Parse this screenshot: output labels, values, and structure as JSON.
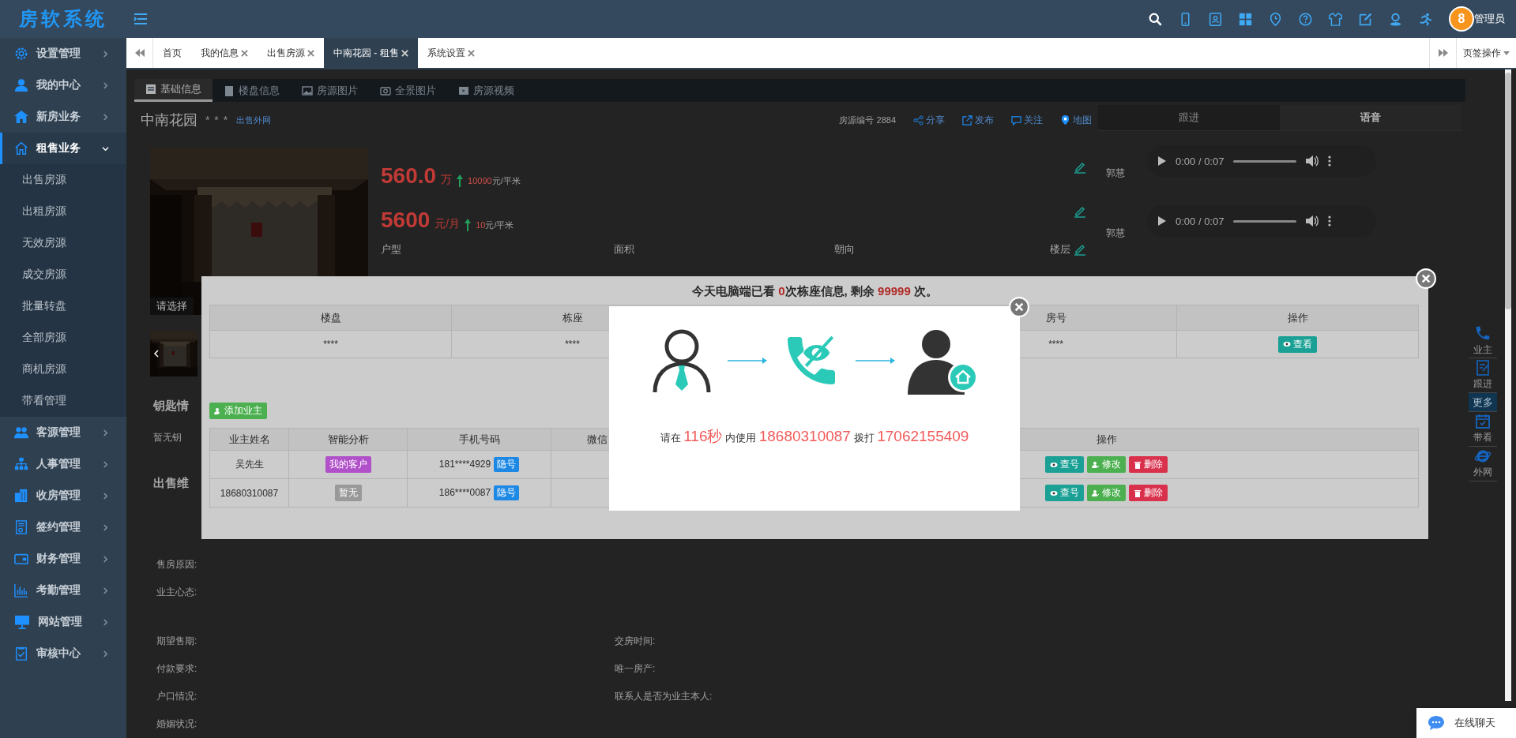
{
  "header": {
    "logo": "房软系统",
    "avatar_text": "8",
    "user": "管理员"
  },
  "sidebar": {
    "items": [
      {
        "label": "设置管理",
        "expanded": false,
        "selected": false
      },
      {
        "label": "我的中心",
        "expanded": false,
        "selected": false
      },
      {
        "label": "新房业务",
        "expanded": false,
        "selected": false
      },
      {
        "label": "租售业务",
        "expanded": true,
        "selected": true,
        "children": [
          {
            "label": "出售房源"
          },
          {
            "label": "出租房源"
          },
          {
            "label": "无效房源"
          },
          {
            "label": "成交房源"
          },
          {
            "label": "批量转盘"
          },
          {
            "label": "全部房源"
          },
          {
            "label": "商机房源"
          },
          {
            "label": "带看管理"
          }
        ]
      },
      {
        "label": "客源管理",
        "expanded": false,
        "selected": false
      },
      {
        "label": "人事管理",
        "expanded": false,
        "selected": false
      },
      {
        "label": "收房管理",
        "expanded": false,
        "selected": false
      },
      {
        "label": "签约管理",
        "expanded": false,
        "selected": false
      },
      {
        "label": "财务管理",
        "expanded": false,
        "selected": false
      },
      {
        "label": "考勤管理",
        "expanded": false,
        "selected": false
      },
      {
        "label": "网站管理",
        "expanded": false,
        "selected": false
      },
      {
        "label": "审核中心",
        "expanded": false,
        "selected": false
      }
    ]
  },
  "page_tabs": {
    "tabs": [
      {
        "label": "首页",
        "closable": false,
        "selected": false
      },
      {
        "label": "我的信息",
        "closable": true,
        "selected": false
      },
      {
        "label": "出售房源",
        "closable": true,
        "selected": false
      },
      {
        "label": "中南花园 - 租售",
        "closable": true,
        "selected": true
      },
      {
        "label": "系统设置",
        "closable": true,
        "selected": false
      }
    ],
    "menu": "页签操作"
  },
  "detail": {
    "tabs": [
      {
        "label": "基础信息",
        "selected": true
      },
      {
        "label": "楼盘信息",
        "selected": false
      },
      {
        "label": "房源图片",
        "selected": false
      },
      {
        "label": "全景图片",
        "selected": false
      },
      {
        "label": "房源视频",
        "selected": false
      }
    ],
    "title": "中南花园",
    "rating": "* * *",
    "link": "出售外网",
    "code": "房源编号 2884",
    "actions": [
      "分享",
      "发布",
      "关注",
      "地图"
    ],
    "prices": [
      {
        "value": "560.0",
        "unit": "万",
        "unit_price": "**10090**元/平米"
      },
      {
        "value": "5600",
        "unit": "元/月",
        "unit_price": "**10**元/平米"
      }
    ],
    "attributes": [
      "户型",
      "面积",
      "朝向",
      "楼层"
    ],
    "photo_caption": "请选择",
    "sections": [
      {
        "kind": "heading",
        "text": "钥匙情"
      },
      {
        "kind": "note",
        "text": "暂无钥"
      },
      {
        "kind": "heading",
        "text": "出售维"
      }
    ],
    "owner_fields": [
      "售房原因:",
      "业主心态:"
    ],
    "sale_fields": [
      {
        "left": "期望售期:",
        "right": "交房时间:"
      },
      {
        "left": "付款要求:",
        "right": "唯一房产:"
      },
      {
        "left": "户口情况:",
        "right": "联系人是否为业主本人:"
      },
      {
        "left": "婚姻状况:"
      }
    ]
  },
  "side_panel": {
    "tabs": [
      {
        "label": "跟进",
        "selected": false
      },
      {
        "label": "语音",
        "selected": true
      }
    ],
    "recordings": [
      {
        "name": "郭慧",
        "time": "0:00 / 0:07"
      },
      {
        "name": "郭慧",
        "time": "0:00 / 0:07"
      }
    ]
  },
  "float_tools": [
    {
      "label": "业主",
      "selected": false
    },
    {
      "label": "跟进",
      "selected": false
    },
    {
      "label": "更多",
      "selected": true
    },
    {
      "label": "带看",
      "selected": false
    },
    {
      "label": "外网",
      "selected": false
    }
  ],
  "quota_dialog": {
    "message": "今天电脑端已看 **0**次栋座信息, 剩余 **99999** 次。",
    "building_table": {
      "columns": [
        "楼盘",
        "栋座",
        "房号",
        "操作"
      ],
      "rows": [
        {
          "cells": [
            "****",
            "****",
            "****"
          ],
          "action": {
            "label": "查看",
            "color": "#1aa094"
          }
        }
      ]
    },
    "add_button": "添加业主",
    "owner_table": {
      "columns": [
        "业主姓名",
        "智能分析",
        "手机号码",
        "微信",
        "操作"
      ],
      "rows": [
        {
          "name": "吴先生",
          "tag": {
            "label": "我的客户",
            "color": "#b151c9"
          },
          "phone": "181****4929",
          "phone_badge": "隐号",
          "actions": [
            {
              "label": "查号",
              "color": "#1aa094"
            },
            {
              "label": "修改",
              "color": "#4cb050"
            },
            {
              "label": "删除",
              "color": "#d9304c"
            }
          ]
        },
        {
          "name": "18680310087",
          "tag": {
            "label": "暂无",
            "color": "#999999"
          },
          "phone": "186****0087",
          "phone_badge": "隐号",
          "actions": [
            {
              "label": "查号",
              "color": "#1aa094"
            },
            {
              "label": "修改",
              "color": "#4cb050"
            },
            {
              "label": "删除",
              "color": "#d9304c"
            }
          ]
        }
      ]
    }
  },
  "call_dialog": {
    "message": "请在 **116秒** 内使用 **18680310087** 拨打 **17062155409**"
  },
  "chat_widget": {
    "label": "在线聊天"
  }
}
